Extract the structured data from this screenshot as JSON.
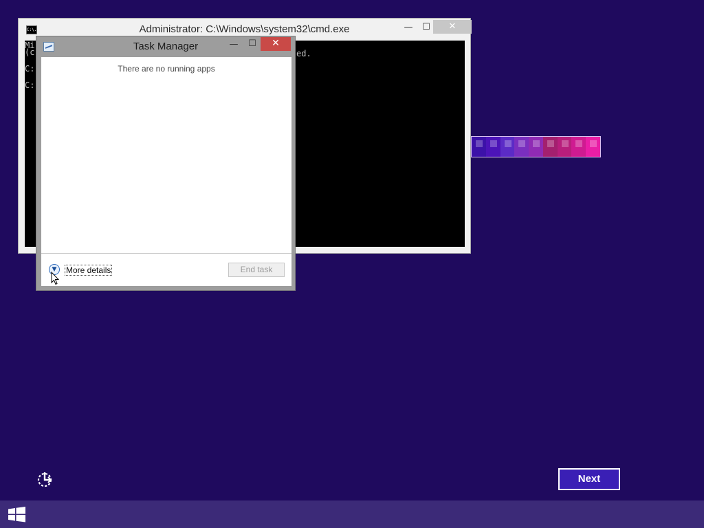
{
  "cmd": {
    "title": "Administrator: C:\\Windows\\system32\\cmd.exe",
    "icon_text": "C:\\.",
    "minimize": "—",
    "maximize": "☐",
    "close": "✕",
    "console_lines": [
      "Mi",
      "(c",
      "C:",
      "C:",
      "ed."
    ]
  },
  "task_manager": {
    "title": "Task Manager",
    "minimize": "—",
    "maximize": "☐",
    "close": "✕",
    "empty_message": "There are no running apps",
    "more_details": "More details",
    "end_task": "End task"
  },
  "setup": {
    "next_label": "Next",
    "strip_colors": [
      "#3c12a8",
      "#4c14b8",
      "#5b2bc6",
      "#7a2fbf",
      "#8f2bb4",
      "#a3206f",
      "#b81e7c",
      "#cf1b91",
      "#ea1ea6"
    ]
  },
  "icons": {
    "accessibility": "accessibility-icon",
    "windows": "windows-logo-icon",
    "cursor": "mouse-pointer-icon"
  },
  "colors": {
    "desktop_bg": "#1f0a5e",
    "taskbar_bg": "#3c2a78",
    "close_red": "#c94a47",
    "next_bg": "#3a1fb5"
  }
}
